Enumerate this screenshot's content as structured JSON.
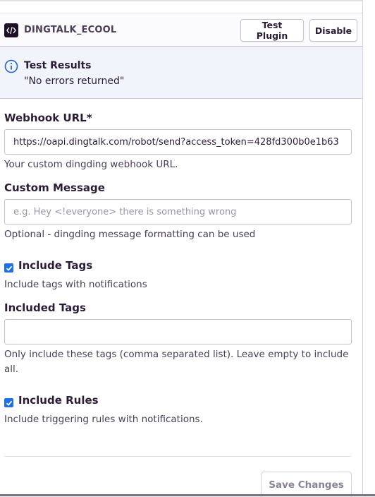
{
  "plugin": {
    "name": "DINGTALK_ECOOL",
    "icon": "code-icon"
  },
  "header": {
    "test_button": "Test Plugin",
    "disable_button": "Disable"
  },
  "results": {
    "icon": "info-icon",
    "title": "Test Results",
    "message": "\"No errors returned\""
  },
  "form": {
    "webhook": {
      "label": "Webhook URL*",
      "value": "https://oapi.dingtalk.com/robot/send?access_token=428fd300b0e1b63",
      "help": "Your custom dingding webhook URL."
    },
    "custom_message": {
      "label": "Custom Message",
      "placeholder": "e.g. Hey <!everyone> there is something wrong",
      "help": "Optional - dingding message formatting can be used"
    },
    "include_tags": {
      "label": "Include Tags",
      "checked": true,
      "help": "Include tags with notifications"
    },
    "included_tags": {
      "label": "Included Tags",
      "value": "",
      "help": "Only include these tags (comma separated list). Leave empty to include all."
    },
    "include_rules": {
      "label": "Include Rules",
      "checked": true,
      "help": "Include triggering rules with notifications."
    },
    "save_button": "Save Changes"
  },
  "colors": {
    "accent": "#1f6fe5",
    "info_bg": "#f1f4fb",
    "text": "#2b1d38"
  }
}
